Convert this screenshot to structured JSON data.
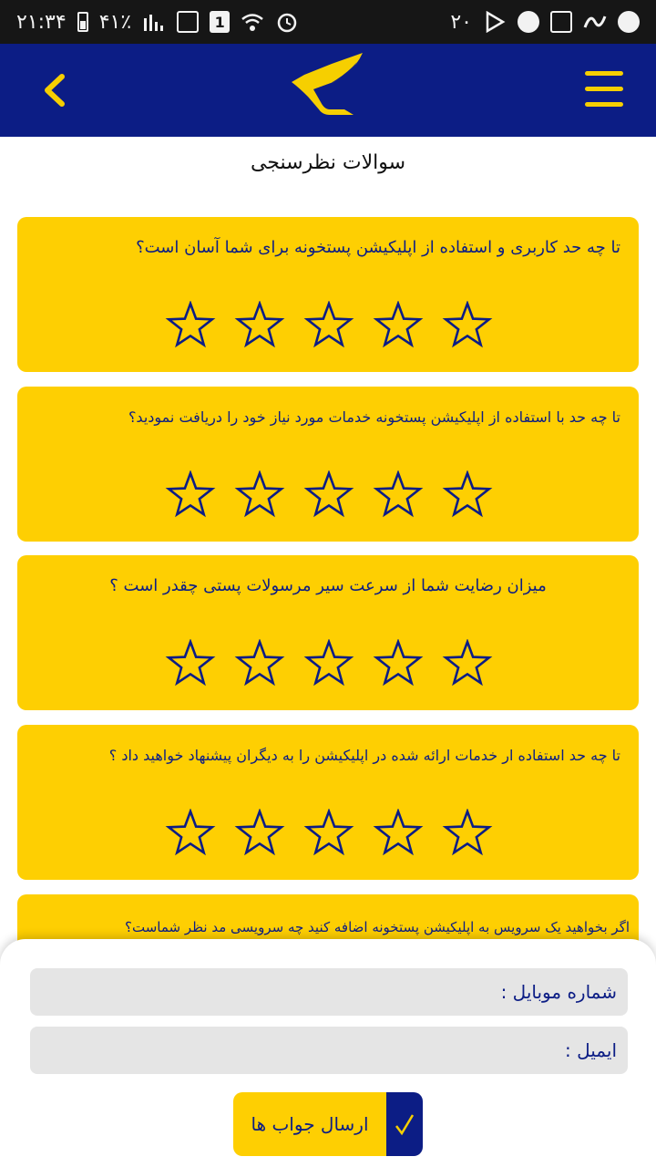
{
  "status_bar": {
    "time": "۲۱:۳۴",
    "battery": "۴۱٪",
    "sim_slot": "1",
    "notification_count": "۲۰"
  },
  "app_bar": {
    "logo": "post-wing-logo",
    "menu_icon": "hamburger-icon",
    "back_icon": "chevron-left-icon",
    "colors": {
      "bar": "#0c1d85",
      "accent": "#f6cf00"
    }
  },
  "page_title": "سوالات نظرسنجی",
  "questions": [
    {
      "text": "تا چه حد کاربری و استفاده از اپلیکیشن پستخونه برای شما آسان است؟",
      "rating": 0,
      "max": 5
    },
    {
      "text": "تا چه حد با استفاده از اپلیکیشن پستخونه خدمات مورد نیاز خود را دریافت نمودید؟",
      "rating": 0,
      "max": 5
    },
    {
      "text": "میزان رضایت شما از سرعت سیر مرسولات پستی چقدر است ؟",
      "rating": 0,
      "max": 5
    },
    {
      "text": "تا چه حد استفاده ار خدمات ارائه شده در اپلیکیشن را به دیگران پیشنهاد خواهید داد ؟",
      "rating": 0,
      "max": 5
    },
    {
      "text": "اگر بخواهید یک سرویس به اپلیکیشن پستخونه اضافه کنید چه سرویسی مد نظر شماست؟"
    }
  ],
  "form": {
    "mobile_placeholder": "شماره موبایل :",
    "mobile_value": "",
    "email_placeholder": "ایمیل :",
    "email_value": "",
    "submit_label": "ارسال جواب ها",
    "submit_icon": "check-icon"
  },
  "colors": {
    "card": "#fecf02",
    "star_outline": "#0c1d85"
  }
}
